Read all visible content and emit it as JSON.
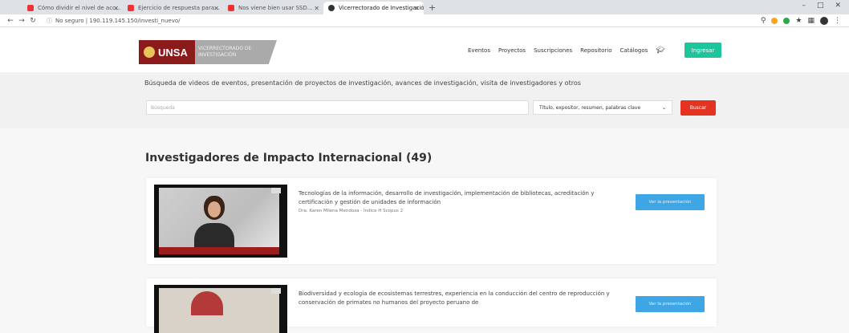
{
  "browser": {
    "tabs": [
      {
        "title": "Cómo dividir el nivel de acc...",
        "favicon_color": "#e33"
      },
      {
        "title": "Ejercicio de respuesta para...",
        "favicon_color": "#e33"
      },
      {
        "title": "Nos viene bien usar SSD...",
        "favicon_color": "#e33"
      },
      {
        "title": "Vicerrectorado de Investigación",
        "favicon_color": "#333"
      }
    ],
    "url": "No seguro | 190.119.145.150/investi_nuevo/",
    "window_controls": [
      "–",
      "□",
      "✕"
    ]
  },
  "header": {
    "logo_brand": "UNSA",
    "logo_sub": "VICERRECTORADO DE INVESTIGACIÓN",
    "nav": [
      "Eventos",
      "Proyectos",
      "Suscripciones",
      "Repositorio",
      "Catálogos"
    ],
    "login_button": "Ingresar"
  },
  "search": {
    "description": "Búsqueda de videos de eventos, presentación de proyectos de investigación, avances de investigación, visita de investigadores y otros",
    "placeholder": "Búsqueda",
    "filter_value": "Título, expositor, resumen, palabras clave",
    "button": "Buscar"
  },
  "main": {
    "title": "Investigadores de Impacto Internacional (49)",
    "cards": [
      {
        "description": "Tecnologías de la información, desarrollo de investigación, implementación de bibliotecas, acreditación y certificación y gestión de unidades de información",
        "meta": "Dra. Karen Milena Mendoza - Índice H Scopus 2",
        "button": "Ver la presentación"
      },
      {
        "description": "Biodiversidad y ecología de ecosistemas terrestres, experiencia en la conducción del centro de reproducción y conservación de primates no humanos del proyecto peruano de",
        "meta": "",
        "button": "Ver la presentación"
      }
    ]
  },
  "colors": {
    "accent_green": "#1dc59c",
    "search_red": "#e53322",
    "button_blue": "#3fa6e6",
    "brand_maroon": "#8b1a1a"
  }
}
